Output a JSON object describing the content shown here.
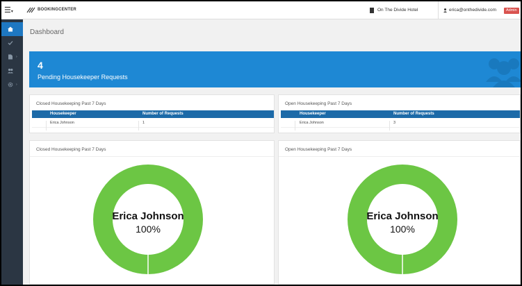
{
  "app": {
    "brand": "BOOKINGCENTER",
    "hotel": "On The Divide Hotel",
    "user_email": "erica@onthedivide.com",
    "user_role": "Admin"
  },
  "page": {
    "title": "Dashboard"
  },
  "stat": {
    "count": "4",
    "label": "Pending Housekeeper Requests"
  },
  "tables": [
    {
      "title": "Closed Housekeeping Past 7 Days",
      "columns": [
        "Housekeeper",
        "Number of Requests"
      ],
      "rows": [
        [
          "Erica Johnson",
          "1"
        ]
      ]
    },
    {
      "title": "Open Housekeeping Past 7 Days",
      "columns": [
        "Housekeeper",
        "Number of Requests"
      ],
      "rows": [
        [
          "Erica Johnson",
          "3"
        ]
      ]
    }
  ],
  "charts": [
    {
      "title": "Closed Housekeeping Past 7 Days",
      "label": "Erica Johnson",
      "percent": "100%",
      "value": 100,
      "color": "#6cc644"
    },
    {
      "title": "Open Housekeeping Past 7 Days",
      "label": "Erica Johnson",
      "percent": "100%",
      "value": 100,
      "color": "#6cc644"
    }
  ],
  "chart_data": [
    {
      "type": "pie",
      "title": "Closed Housekeeping Past 7 Days",
      "categories": [
        "Erica Johnson"
      ],
      "values": [
        100
      ]
    },
    {
      "type": "pie",
      "title": "Open Housekeeping Past 7 Days",
      "categories": [
        "Erica Johnson"
      ],
      "values": [
        100
      ]
    }
  ],
  "icons": {
    "menu": "menu-icon",
    "hotel": "building-icon",
    "user": "user-icon",
    "sidebar": [
      "home-icon",
      "check-icon",
      "document-icon",
      "users-icon",
      "gear-icon"
    ]
  }
}
